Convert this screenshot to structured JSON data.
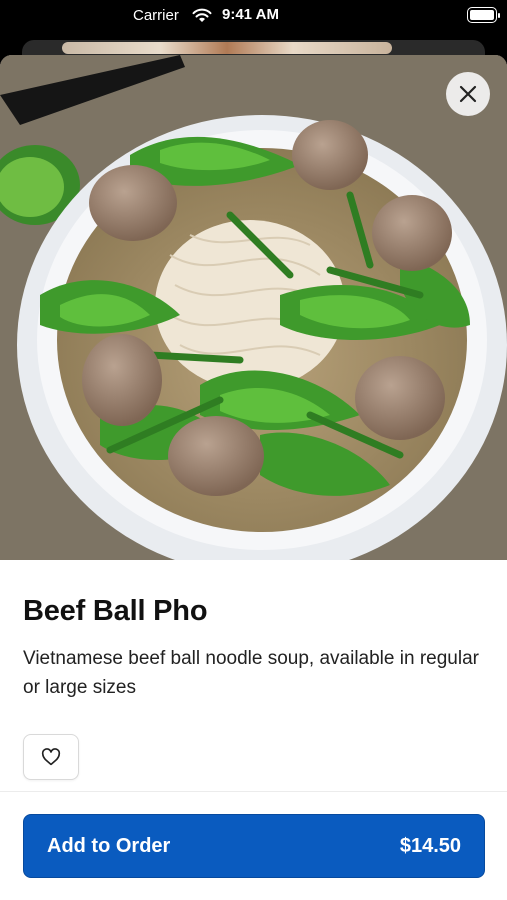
{
  "status_bar": {
    "carrier": "Carrier",
    "time": "9:41 AM"
  },
  "item": {
    "name": "Beef Ball Pho",
    "description": "Vietnamese beef ball noodle soup, available in regular or large sizes",
    "image_icon": "food-photo"
  },
  "actions": {
    "close_icon": "close-icon",
    "favorite_icon": "heart-icon",
    "add_label": "Add to Order",
    "price": "$14.50"
  },
  "colors": {
    "primary_button": "#0a5bbf",
    "text_primary": "#111111"
  }
}
